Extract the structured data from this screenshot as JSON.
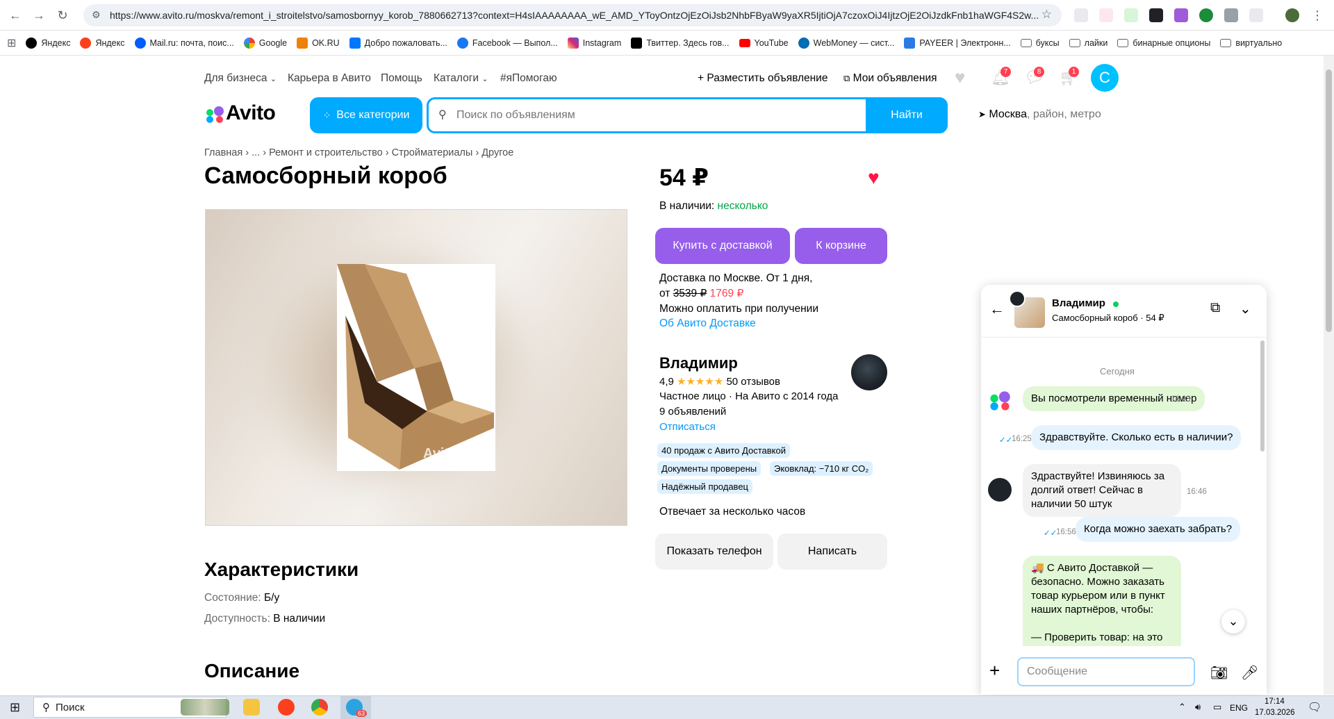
{
  "browser": {
    "url": "https://www.avito.ru/moskva/remont_i_stroitelstvo/samosbornyy_korob_7880662713?context=H4sIAAAAAAAA_wE_AMD_YToyOntzOjEzOiJsb2NhbFByaW9yaXR5IjtiOjA7czoxOiJ4IjtzOjE2OiJzdkFnb1haWGF4S2w..."
  },
  "bookmarks": [
    {
      "label": "Яндекс",
      "color": "#000000"
    },
    {
      "label": "Яндекс",
      "color": "#fc3f1d"
    },
    {
      "label": "Mail.ru: почта, поис...",
      "color": "#005ff9"
    },
    {
      "label": "Google",
      "color": "#ea4335"
    },
    {
      "label": "OK.RU",
      "color": "#ee8208"
    },
    {
      "label": "Добро пожаловать...",
      "color": "#0077ff"
    },
    {
      "label": "Facebook — Выпол...",
      "color": "#1877f2"
    },
    {
      "label": "Instagram",
      "color": "#d62976"
    },
    {
      "label": "Твиттер. Здесь гов...",
      "color": "#000000"
    },
    {
      "label": "YouTube",
      "color": "#ff0000"
    },
    {
      "label": "WebMoney — сист...",
      "color": "#036cb5"
    },
    {
      "label": "PAYEER | Электронн...",
      "color": "#2a7be4"
    },
    {
      "label": "буксы",
      "color": "folder"
    },
    {
      "label": "лайки",
      "color": "folder"
    },
    {
      "label": "бинарные опционы",
      "color": "folder"
    },
    {
      "label": "виртуально",
      "color": "folder"
    }
  ],
  "topnav": {
    "business": "Для бизнеса",
    "career": "Карьера в Авито",
    "help": "Помощь",
    "catalogs": "Каталоги",
    "ihelp": "#яПомогаю",
    "post_ad": "Разместить объявление",
    "my_ads": "Мои объявления",
    "notif_badge": "7",
    "msg_badge": "8",
    "cart_badge": "1",
    "user_initial": "С"
  },
  "header": {
    "logo": "Avito",
    "all_categories": "Все категории",
    "search_placeholder": "Поиск по объявлениям",
    "search_button": "Найти",
    "location_city": "Москва",
    "location_rest": ", район, метро"
  },
  "breadcrumb": [
    "Главная",
    "...",
    "Ремонт и строительство",
    "Стройматериалы",
    "Другое"
  ],
  "product": {
    "title": "Самосборный короб",
    "price": "54 ₽",
    "availability_label": "В наличии: ",
    "availability_value": "несколько",
    "buy_delivery": "Купить с доставкой",
    "to_cart": "К корзине",
    "delivery_line1": "Доставка по Москве. От 1 дня,",
    "delivery_from": "от ",
    "delivery_old_price": "3539 ₽",
    "delivery_new_price": "1769 ₽",
    "pay_on_receipt": "Можно оплатить при получении",
    "about_delivery": "Об Авито Доставке",
    "watermark": "Avito"
  },
  "seller": {
    "name": "Владимир",
    "rating": "4,9",
    "stars": "★★★★★",
    "reviews": "50 отзывов",
    "type": "Частное лицо · На Авито с 2014 года",
    "ads_count": "9 объявлений",
    "unsubscribe": "Отписаться",
    "badges": [
      "40 продаж с Авито Доставкой",
      "Документы проверены",
      "Эковклад: −710 кг CO₂",
      "Надёжный продавец"
    ],
    "response_time": "Отвечает за несколько часов",
    "show_phone": "Показать телефон",
    "write": "Написать"
  },
  "characteristics": {
    "heading": "Характеристики",
    "condition_label": "Состояние: ",
    "condition_value": "Б/у",
    "availability_label": "Доступность: ",
    "availability_value": "В наличии"
  },
  "description": {
    "heading": "Описание"
  },
  "chat": {
    "name": "Владимир",
    "subtitle": "Самосборный короб · 54 ₽",
    "date": "Сегодня",
    "messages": [
      {
        "text": "Вы посмотрели временный номер",
        "time": "16:23"
      },
      {
        "text": "Здравствуйте. Сколько есть в наличии?",
        "time": "16:25"
      },
      {
        "text": "Здраствуйте! Извиняюсь за долгий ответ! Сейчас в наличии 50 штук",
        "time": "16:46"
      },
      {
        "text": "Когда можно заехать забрать?",
        "time": "16:56"
      },
      {
        "text": "🚚 С Авито Доставкой — безопасно. Можно заказать товар курьером или в пункт наших партнёров, чтобы:\n\n— Проверить товар: на это будет",
        "time": ""
      }
    ],
    "input_placeholder": "Сообщение"
  },
  "taskbar": {
    "search": "Поиск",
    "lang": "ENG",
    "time": "17:14",
    "date": "17.03.2026",
    "telegram_badge": "63"
  }
}
